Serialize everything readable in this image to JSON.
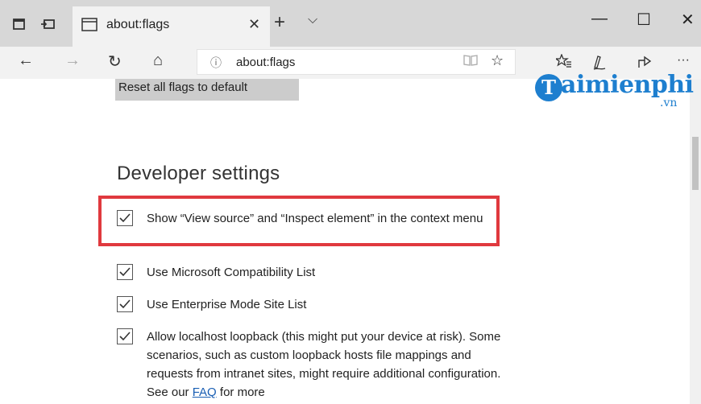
{
  "tab": {
    "title": "about:flags",
    "close_glyph": "✕",
    "new_tab_glyph": "+",
    "tab_menu_glyph": "⌵"
  },
  "window_controls": {
    "minimize": "—",
    "maximize": "☐",
    "close": "✕"
  },
  "address_bar": {
    "url": "about:flags",
    "info_glyph": "ⓘ",
    "favorite_glyph": "☆"
  },
  "nav": {
    "back": "←",
    "forward": "→",
    "refresh": "↻",
    "home": "⌂",
    "more": "···"
  },
  "watermark": {
    "main": "aimienphi",
    "initial": "T",
    "suffix": ".vn"
  },
  "page": {
    "reset_button": "Reset all flags to default",
    "section_title": "Developer settings",
    "flags": [
      {
        "label": "Show “View source” and “Inspect element” in the context menu",
        "checked": true
      },
      {
        "label": "Use Microsoft Compatibility List",
        "checked": true
      },
      {
        "label": "Use Enterprise Mode Site List",
        "checked": true
      },
      {
        "label_before_link": "Allow localhost loopback (this might put your device at risk). Some scenarios, such as custom loopback hosts file mappings and requests from intranet sites, might require additional configuration. See our ",
        "link": "FAQ",
        "label_after_link": " for more",
        "checked": true
      }
    ]
  },
  "colors": {
    "highlight_border": "#e0393e",
    "link": "#1a5fb4",
    "logo_blue": "#1e7fcf"
  },
  "icons": [
    "tab-manager-icon",
    "set-aside-tabs-icon",
    "page-icon",
    "reading-view-icon",
    "favorites-star-icon",
    "favorites-hub-icon",
    "pen-icon",
    "share-icon",
    "checkmark-icon"
  ]
}
